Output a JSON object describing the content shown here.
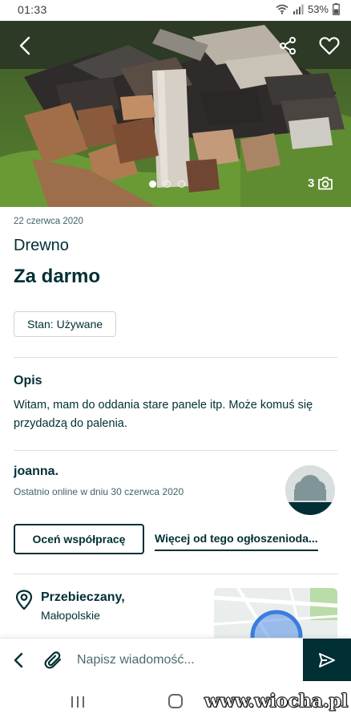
{
  "status_bar": {
    "time": "01:33",
    "battery": "53%"
  },
  "gallery": {
    "photo_count": "3",
    "active_index": 0,
    "total_dots": 3
  },
  "listing": {
    "date": "22 czerwca 2020",
    "title": "Drewno",
    "price": "Za darmo",
    "condition_tag": "Stan: Używane"
  },
  "description": {
    "heading": "Opis",
    "text": "Witam, mam do oddania stare panele itp. Może komuś się przydadzą do palenia."
  },
  "seller": {
    "name": "joanna.",
    "last_seen": "Ostatnio online w dniu 30 czerwca 2020",
    "rate_button": "Oceń współpracę",
    "more_link": "Więcej od tego ogłoszenioda..."
  },
  "location": {
    "city": "Przebieczany,",
    "region": "Małopolskie"
  },
  "message_bar": {
    "placeholder": "Napisz wiadomość..."
  },
  "watermark": "www.wiocha.pl",
  "colors": {
    "primary": "#002f34",
    "secondary_text": "#406367",
    "divider": "#d8dfe0",
    "map_circle": "#3b7de0"
  }
}
